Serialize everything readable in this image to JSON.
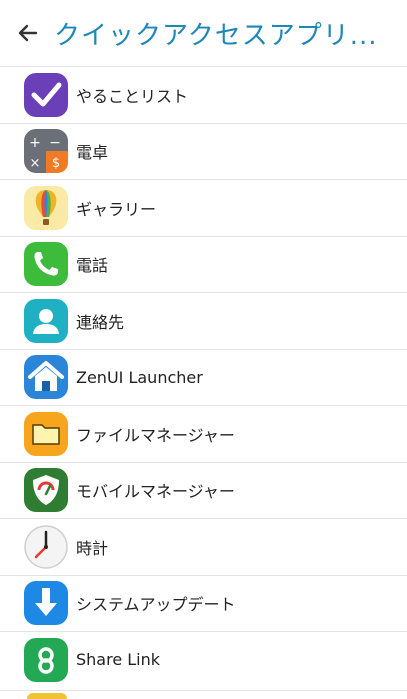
{
  "header": {
    "back_icon": "arrow-left-icon",
    "title": "クイックアクセスアプリ..."
  },
  "apps": [
    {
      "label": "やることリスト",
      "icon": "todo-check-icon"
    },
    {
      "label": "電卓",
      "icon": "calculator-icon"
    },
    {
      "label": "ギャラリー",
      "icon": "gallery-balloon-icon"
    },
    {
      "label": "電話",
      "icon": "phone-icon"
    },
    {
      "label": "連絡先",
      "icon": "contacts-icon"
    },
    {
      "label": "ZenUI Launcher",
      "icon": "launcher-home-icon"
    },
    {
      "label": "ファイルマネージャー",
      "icon": "folder-icon"
    },
    {
      "label": "モバイルマネージャー",
      "icon": "shield-gauge-icon"
    },
    {
      "label": "時計",
      "icon": "clock-icon"
    },
    {
      "label": "システムアップデート",
      "icon": "download-update-icon"
    },
    {
      "label": "Share Link",
      "icon": "share-link-icon"
    }
  ],
  "colors": {
    "accent": "#1f87b8",
    "divider": "#e4e4e4"
  }
}
